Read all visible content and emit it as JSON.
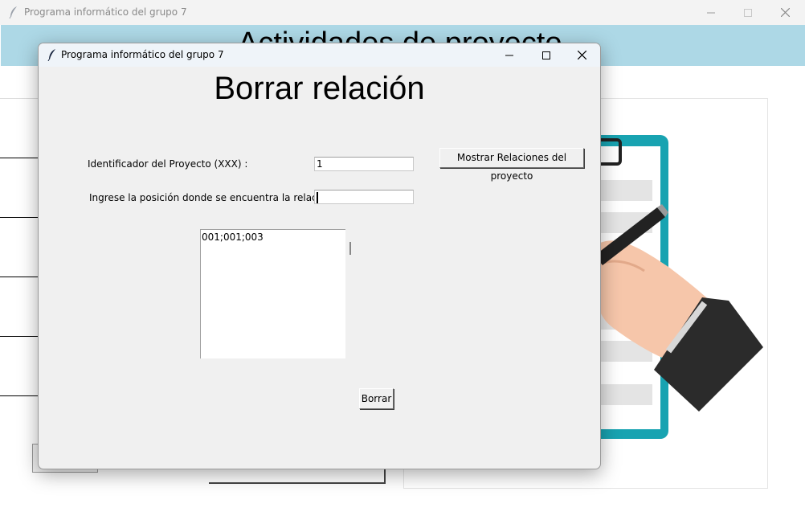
{
  "main_window": {
    "title": "Programa informático del grupo 7",
    "header_text": "Actividades de proyecto"
  },
  "dialog": {
    "title": "Programa informático del grupo 7",
    "heading": "Borrar relación",
    "project_id_label": "Identificador del Proyecto (XXX) :",
    "project_id_value": "1",
    "position_label": "Ingrese la posición donde se encuentra la relación:",
    "position_value": "",
    "show_relations_button": "Mostrar Relaciones del proyecto",
    "relations_list": [
      "001;001;003"
    ],
    "delete_button": "Borrar"
  },
  "icons": {
    "app": "feather-icon",
    "minimize": "minimize-icon",
    "maximize": "maximize-icon",
    "close": "close-icon"
  }
}
